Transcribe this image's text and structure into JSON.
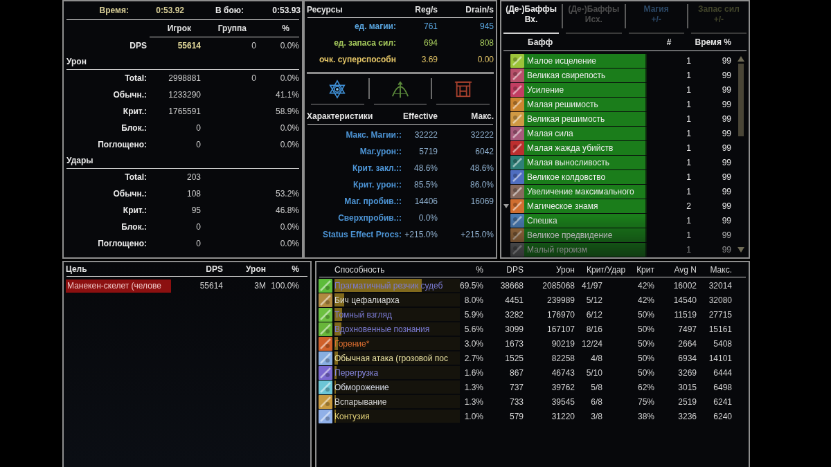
{
  "summary": {
    "time_label": "Время:",
    "time_value": "0:53.92",
    "combat_label": "В бою:",
    "combat_value": "0:53.93",
    "columns": [
      "Игрок",
      "Группа",
      "%"
    ],
    "dps": {
      "label": "DPS",
      "player": "55614",
      "group": "0",
      "percent": "0.0%"
    },
    "sections": [
      {
        "title": "Урон",
        "rows": [
          {
            "label": "Total:",
            "player": "2998881",
            "group": "0",
            "percent": "0.0%"
          },
          {
            "label": "Обычн.:",
            "player": "1233290",
            "percent": "41.1%"
          },
          {
            "label": "Крит.:",
            "player": "1765591",
            "percent": "58.9%"
          },
          {
            "label": "Блок.:",
            "player": "0",
            "percent": "0.0%"
          },
          {
            "label": "Поглощено:",
            "player": "0",
            "percent": "0.0%"
          }
        ]
      },
      {
        "title": "Удары",
        "rows": [
          {
            "label": "Total:",
            "player": "203"
          },
          {
            "label": "Обычн.:",
            "player": "108",
            "percent": "53.2%"
          },
          {
            "label": "Крит.:",
            "player": "95",
            "percent": "46.8%"
          },
          {
            "label": "Блок.:",
            "player": "0",
            "percent": "0.0%"
          },
          {
            "label": "Поглощено:",
            "player": "0",
            "percent": "0.0%"
          }
        ]
      }
    ]
  },
  "resources": {
    "columns": [
      "Ресурсы",
      "Reg/s",
      "Drain/s"
    ],
    "rows": [
      {
        "label": "ед. магии:",
        "reg": "761",
        "drain": "945",
        "color": "#5aa6e0"
      },
      {
        "label": "ед. запаса сил:",
        "reg": "694",
        "drain": "808",
        "color": "#a6ca5c"
      },
      {
        "label": "очк. суперспособн",
        "reg": "3.69",
        "drain": "0.00",
        "color": "#e4c566"
      }
    ]
  },
  "stats": {
    "columns": [
      "Характеристики",
      "Effective",
      "Макс."
    ],
    "rows": [
      {
        "label": "Макс. Магии::",
        "effective": "32222",
        "max": "32222"
      },
      {
        "label": "Маг.урон::",
        "effective": "5719",
        "max": "6042"
      },
      {
        "label": "Крит. закл.::",
        "effective": "48.6%",
        "max": "48.6%"
      },
      {
        "label": "Крит. урон::",
        "effective": "85.5%",
        "max": "86.0%"
      },
      {
        "label": "Маг. пробив.::",
        "effective": "14406",
        "max": "16069"
      },
      {
        "label": "Сверхпробив.::",
        "effective": "0.0%"
      },
      {
        "label": "Status Effect Procs:",
        "effective": "+215.0%",
        "max": "+215.0%"
      }
    ]
  },
  "buffs": {
    "tabs": [
      {
        "label": "(Де-)Баффы\nВх.",
        "selected": true,
        "color": "#f2f2f2"
      },
      {
        "label": "(Де-)Баффы\nИсх.",
        "selected": false,
        "color": "#4c4c4c"
      },
      {
        "label": "Магия\n+/-",
        "selected": false,
        "color": "#2c4866"
      },
      {
        "label": "Запас сил\n+/-",
        "selected": false,
        "color": "#41442b"
      }
    ],
    "columns": [
      "Бафф",
      "#",
      "Время %"
    ],
    "rows": [
      {
        "name": "Малое исцеление",
        "count": "1",
        "time": "99",
        "level": 0.99,
        "expandable": false
      },
      {
        "name": "Великая свирепость",
        "count": "1",
        "time": "99",
        "level": 0.99,
        "expandable": false
      },
      {
        "name": "Усиление",
        "count": "1",
        "time": "99",
        "level": 0.99,
        "expandable": false
      },
      {
        "name": "Малая решимость",
        "count": "1",
        "time": "99",
        "level": 0.99,
        "expandable": false
      },
      {
        "name": "Великая решимость",
        "count": "1",
        "time": "99",
        "level": 0.99,
        "expandable": false
      },
      {
        "name": "Малая сила",
        "count": "1",
        "time": "99",
        "level": 0.99,
        "expandable": false
      },
      {
        "name": "Малая жажда убийств",
        "count": "1",
        "time": "99",
        "level": 0.99,
        "expandable": false
      },
      {
        "name": "Малая выносливость",
        "count": "1",
        "time": "99",
        "level": 0.99,
        "expandable": false
      },
      {
        "name": "Великое колдовство",
        "count": "1",
        "time": "99",
        "level": 0.99,
        "expandable": false
      },
      {
        "name": "Увеличение максимального",
        "count": "1",
        "time": "99",
        "level": 0.99,
        "expandable": false
      },
      {
        "name": "Магическое знамя",
        "count": "2",
        "time": "99",
        "level": 0.99,
        "expandable": true
      },
      {
        "name": "Спешка",
        "count": "1",
        "time": "99",
        "level": 0.99,
        "expandable": false
      },
      {
        "name": "Великое предвидение",
        "count": "1",
        "time": "99",
        "level": 0.99,
        "expandable": false
      },
      {
        "name": "Малый героизм",
        "count": "1",
        "time": "99",
        "level": 0.99,
        "expandable": false
      }
    ]
  },
  "targets": {
    "columns": [
      "Цель",
      "DPS",
      "Урон",
      "%"
    ],
    "rows": [
      {
        "name": "Манекен-скелет (челове",
        "dps": "55614",
        "damage": "3M",
        "percent": "100.0%",
        "level": 1
      }
    ]
  },
  "abilities": {
    "columns": [
      "Способность",
      "%",
      "DPS",
      "Урон",
      "Крит/Удар",
      "Крит",
      "Avg N",
      "Макс."
    ],
    "rows": [
      {
        "name": "Прагматичный резчик судеб",
        "percent": "69.5%",
        "dps": "38668",
        "damage": "2085068",
        "crit_hits": "41/97",
        "crit": "42%",
        "avg": "16002",
        "max": "32014",
        "level": 0.695,
        "color": "#7c7cd6"
      },
      {
        "name": "Бич цефалиарха",
        "percent": "8.0%",
        "dps": "4451",
        "damage": "239989",
        "crit_hits": "5/12",
        "crit": "42%",
        "avg": "14540",
        "max": "32080",
        "level": 0.08,
        "color": "#dadada"
      },
      {
        "name": "Томный взгляд",
        "percent": "5.9%",
        "dps": "3282",
        "damage": "176970",
        "crit_hits": "6/12",
        "crit": "50%",
        "avg": "11519",
        "max": "27715",
        "level": 0.059,
        "color": "#7c7cd6"
      },
      {
        "name": "Вдохновенные познания",
        "percent": "5.6%",
        "dps": "3099",
        "damage": "167107",
        "crit_hits": "8/16",
        "crit": "50%",
        "avg": "7497",
        "max": "15161",
        "level": 0.056,
        "color": "#7c7cd6"
      },
      {
        "name": "Горение*",
        "percent": "3.0%",
        "dps": "1673",
        "damage": "90219",
        "crit_hits": "12/24",
        "crit": "50%",
        "avg": "2664",
        "max": "5408",
        "level": 0.03,
        "color": "#e07030"
      },
      {
        "name": "Обычная атака (грозовой пос",
        "percent": "2.7%",
        "dps": "1525",
        "damage": "82258",
        "crit_hits": "4/8",
        "crit": "50%",
        "avg": "6934",
        "max": "14101",
        "level": 0.027,
        "color": "#e8e0a0"
      },
      {
        "name": "Перегрузка",
        "percent": "1.6%",
        "dps": "867",
        "damage": "46743",
        "crit_hits": "5/10",
        "crit": "50%",
        "avg": "3269",
        "max": "6444",
        "level": 0.016,
        "color": "#8a8ae6"
      },
      {
        "name": "Обморожение",
        "percent": "1.3%",
        "dps": "737",
        "damage": "39762",
        "crit_hits": "5/8",
        "crit": "62%",
        "avg": "3015",
        "max": "6498",
        "level": 0.013,
        "color": "#d8dde8"
      },
      {
        "name": "Вспарывание",
        "percent": "1.3%",
        "dps": "733",
        "damage": "39545",
        "crit_hits": "6/8",
        "crit": "75%",
        "avg": "2519",
        "max": "6241",
        "level": 0.013,
        "color": "#d6d6d6"
      },
      {
        "name": "Контузия",
        "percent": "1.0%",
        "dps": "579",
        "damage": "31220",
        "crit_hits": "3/8",
        "crit": "38%",
        "avg": "3236",
        "max": "6240",
        "level": 0.01,
        "color": "#e6d47a"
      }
    ]
  }
}
